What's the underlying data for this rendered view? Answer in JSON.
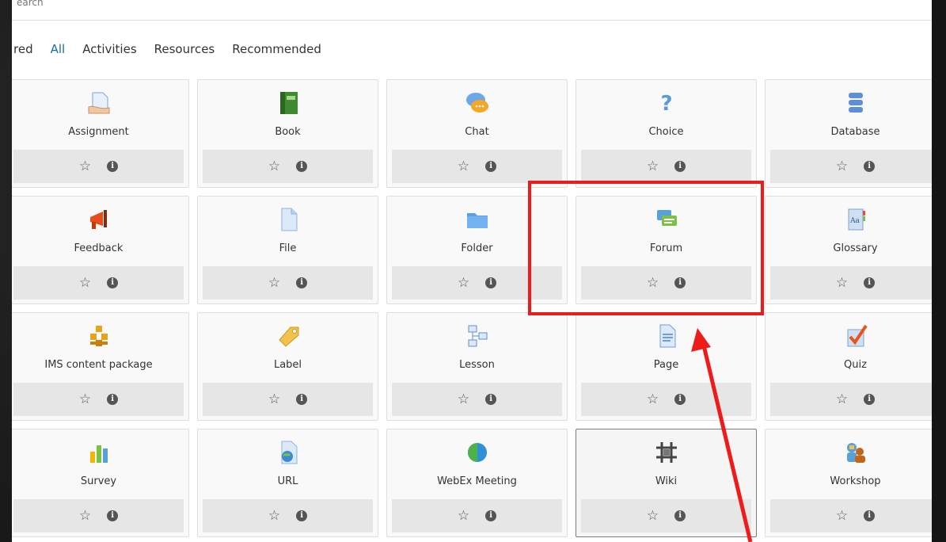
{
  "search": {
    "placeholder_visible": "earch"
  },
  "tabs": [
    {
      "label": "red",
      "active": false
    },
    {
      "label": "All",
      "active": true
    },
    {
      "label": "Activities",
      "active": false
    },
    {
      "label": "Resources",
      "active": false
    },
    {
      "label": "Recommended",
      "active": false
    }
  ],
  "modules": [
    {
      "label": "Assignment",
      "icon": "assignment-icon"
    },
    {
      "label": "Book",
      "icon": "book-icon"
    },
    {
      "label": "Chat",
      "icon": "chat-icon"
    },
    {
      "label": "Choice",
      "icon": "choice-icon"
    },
    {
      "label": "Database",
      "icon": "database-icon"
    },
    {
      "label": "Feedback",
      "icon": "feedback-icon"
    },
    {
      "label": "File",
      "icon": "file-icon"
    },
    {
      "label": "Folder",
      "icon": "folder-icon"
    },
    {
      "label": "Forum",
      "icon": "forum-icon"
    },
    {
      "label": "Glossary",
      "icon": "glossary-icon"
    },
    {
      "label": "IMS content package",
      "icon": "ims-package-icon"
    },
    {
      "label": "Label",
      "icon": "label-icon"
    },
    {
      "label": "Lesson",
      "icon": "lesson-icon"
    },
    {
      "label": "Page",
      "icon": "page-icon"
    },
    {
      "label": "Quiz",
      "icon": "quiz-icon"
    },
    {
      "label": "Survey",
      "icon": "survey-icon"
    },
    {
      "label": "URL",
      "icon": "url-icon"
    },
    {
      "label": "WebEx Meeting",
      "icon": "webex-icon"
    },
    {
      "label": "Wiki",
      "icon": "wiki-icon"
    },
    {
      "label": "Workshop",
      "icon": "workshop-icon"
    }
  ],
  "footer_icons": {
    "star": "star-outline-icon",
    "info": "info-icon"
  },
  "colors": {
    "accent_tab": "#1a6ea8",
    "annotation_red": "#ee1b1b"
  }
}
